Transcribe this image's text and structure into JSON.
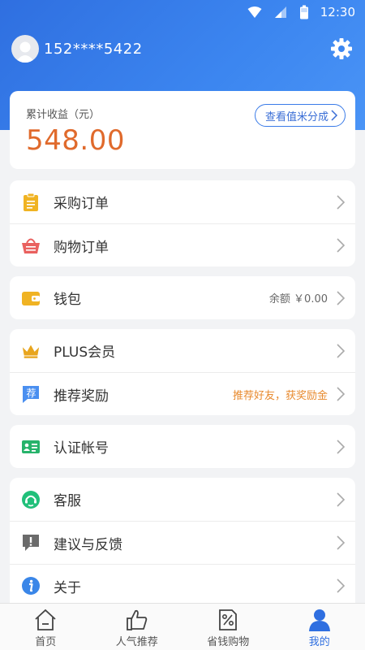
{
  "status": {
    "time": "12:30"
  },
  "profile": {
    "phone": "152****5422"
  },
  "earnings": {
    "label": "累计收益（元）",
    "value": "548.00",
    "link": "查看值米分成"
  },
  "groups": [
    {
      "items": [
        {
          "label": "采购订单",
          "icon": "clipboard-icon"
        },
        {
          "label": "购物订单",
          "icon": "basket-icon"
        }
      ]
    },
    {
      "items": [
        {
          "label": "钱包",
          "icon": "wallet-icon",
          "extra": "余额 ￥0.00"
        }
      ]
    },
    {
      "items": [
        {
          "label": "PLUS会员",
          "icon": "crown-icon"
        },
        {
          "label": "推荐奖励",
          "icon": "recommend-icon",
          "extra": "推荐好友，获奖励金"
        }
      ]
    },
    {
      "items": [
        {
          "label": "认证帐号",
          "icon": "id-card-icon"
        }
      ]
    },
    {
      "items": [
        {
          "label": "客服",
          "icon": "headset-icon"
        },
        {
          "label": "建议与反馈",
          "icon": "feedback-icon"
        },
        {
          "label": "关于",
          "icon": "info-icon"
        }
      ]
    }
  ],
  "tabs": [
    {
      "label": "首页",
      "icon": "home-icon"
    },
    {
      "label": "人气推荐",
      "icon": "thumbs-up-icon"
    },
    {
      "label": "省钱购物",
      "icon": "discount-icon"
    },
    {
      "label": "我的",
      "icon": "person-icon",
      "active": true
    }
  ],
  "colors": {
    "accent": "#2f6fe0",
    "earnings": "#e06a2c",
    "promo": "#e88a2e"
  },
  "icons": {
    "recommend_glyph": "荐"
  }
}
